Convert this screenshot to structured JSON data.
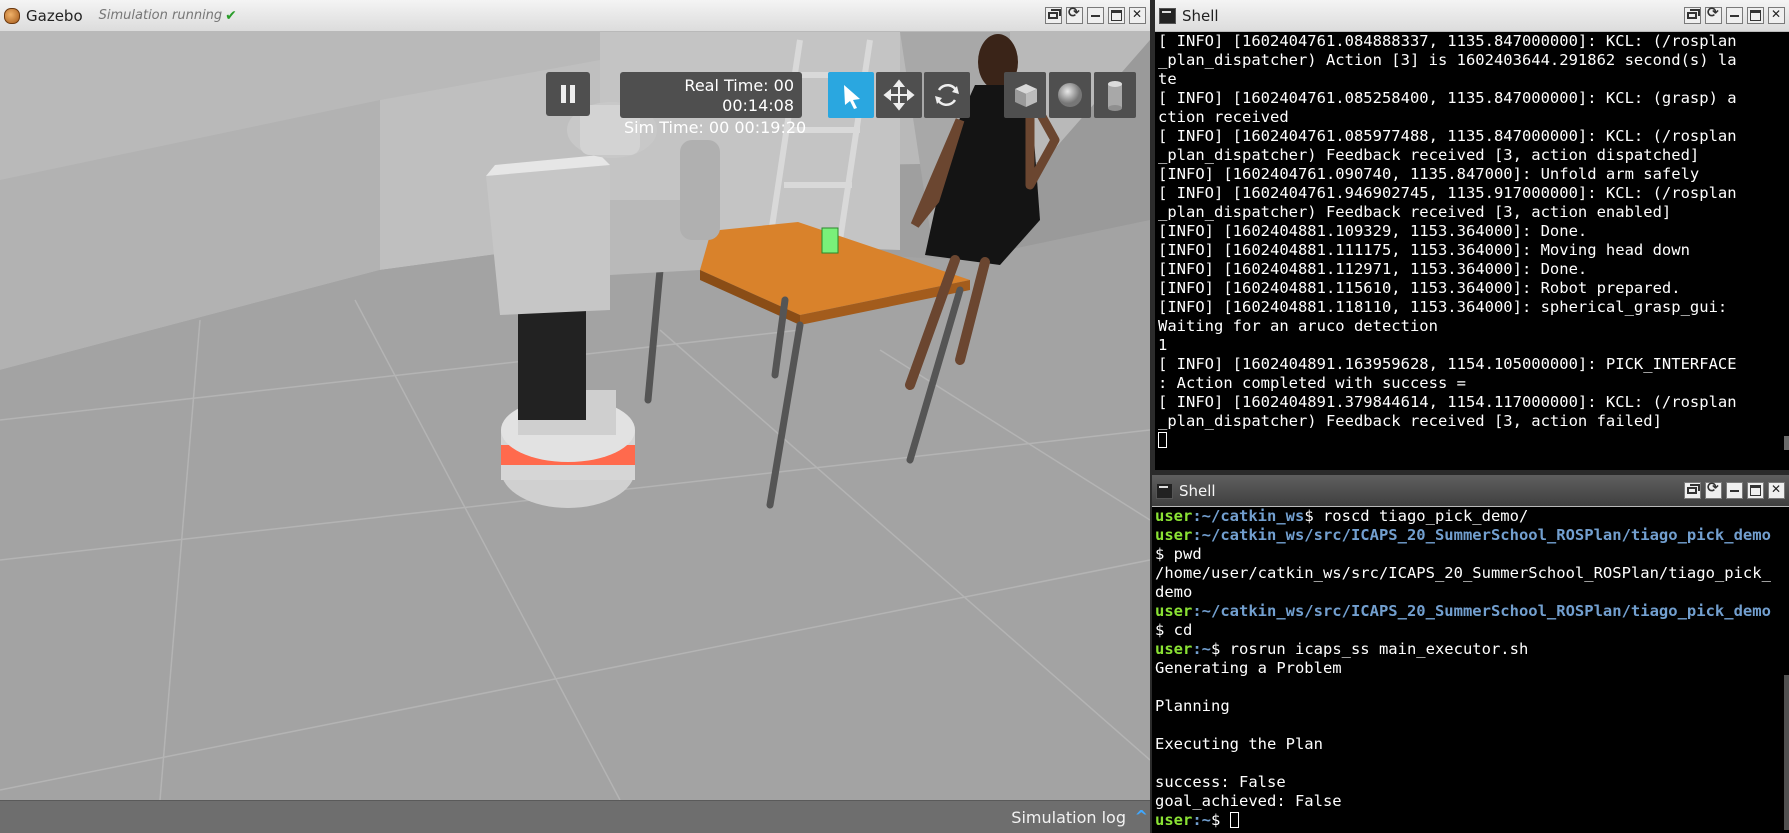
{
  "gazebo": {
    "title": "Gazebo",
    "status": "Simulation running",
    "status_icon": "checkmark-icon",
    "toolbar": {
      "real_time_line1": "Real Time: 00",
      "real_time_line2": "00:14:08",
      "sim_time": "Sim Time: 00 00:19:20",
      "tools": [
        "select-arrow-icon",
        "translate-icon",
        "rotate-icon",
        "box-shape-icon",
        "sphere-shape-icon",
        "cylinder-shape-icon"
      ]
    },
    "sim_log_label": "Simulation log",
    "colors": {
      "select_active": "#2aa7e0",
      "table": "#d9822b",
      "robot_base_stripe": "#ff6a4d"
    }
  },
  "shell_top": {
    "title": "Shell",
    "lines": [
      "[ INFO] [1602404761.084888337, 1135.847000000]: KCL: (/rosplan",
      "_plan_dispatcher) Action [3] is 1602403644.291862 second(s) la",
      "te",
      "[ INFO] [1602404761.085258400, 1135.847000000]: KCL: (grasp) a",
      "ction received",
      "[ INFO] [1602404761.085977488, 1135.847000000]: KCL: (/rosplan",
      "_plan_dispatcher) Feedback received [3, action dispatched]",
      "[INFO] [1602404761.090740, 1135.847000]: Unfold arm safely",
      "[ INFO] [1602404761.946902745, 1135.917000000]: KCL: (/rosplan",
      "_plan_dispatcher) Feedback received [3, action enabled]",
      "[INFO] [1602404881.109329, 1153.364000]: Done.",
      "[INFO] [1602404881.111175, 1153.364000]: Moving head down",
      "[INFO] [1602404881.112971, 1153.364000]: Done.",
      "[INFO] [1602404881.115610, 1153.364000]: Robot prepared.",
      "[INFO] [1602404881.118110, 1153.364000]: spherical_grasp_gui:",
      "Waiting for an aruco detection",
      "1",
      "[ INFO] [1602404891.163959628, 1154.105000000]: PICK_INTERFACE",
      ": Action completed with success =",
      "[ INFO] [1602404891.379844614, 1154.117000000]: KCL: (/rosplan",
      "_plan_dispatcher) Feedback received [3, action failed]"
    ]
  },
  "shell_bottom": {
    "title": "Shell",
    "prompt_user": "user",
    "path_home": ":~",
    "path_ws": ":~/catkin_ws",
    "path_demo": ":~/catkin_ws/src/ICAPS_20_SummerSchool_ROSPlan/tiago_pick_demo",
    "cmd1": "$ roscd tiago_pick_demo/",
    "cmd2": "$ pwd",
    "pwd_out1": "/home/user/catkin_ws/src/ICAPS_20_SummerSchool_ROSPlan/tiago_pick_",
    "pwd_out2": "demo",
    "cmd3": "$ cd",
    "cmd4": "$ rosrun icaps_ss main_executor.sh",
    "out1": "Generating a Problem",
    "out2": "Planning",
    "out3": "Executing the Plan",
    "out4": "success: False",
    "out5": "goal_achieved: False",
    "prompt_end": "$ "
  }
}
